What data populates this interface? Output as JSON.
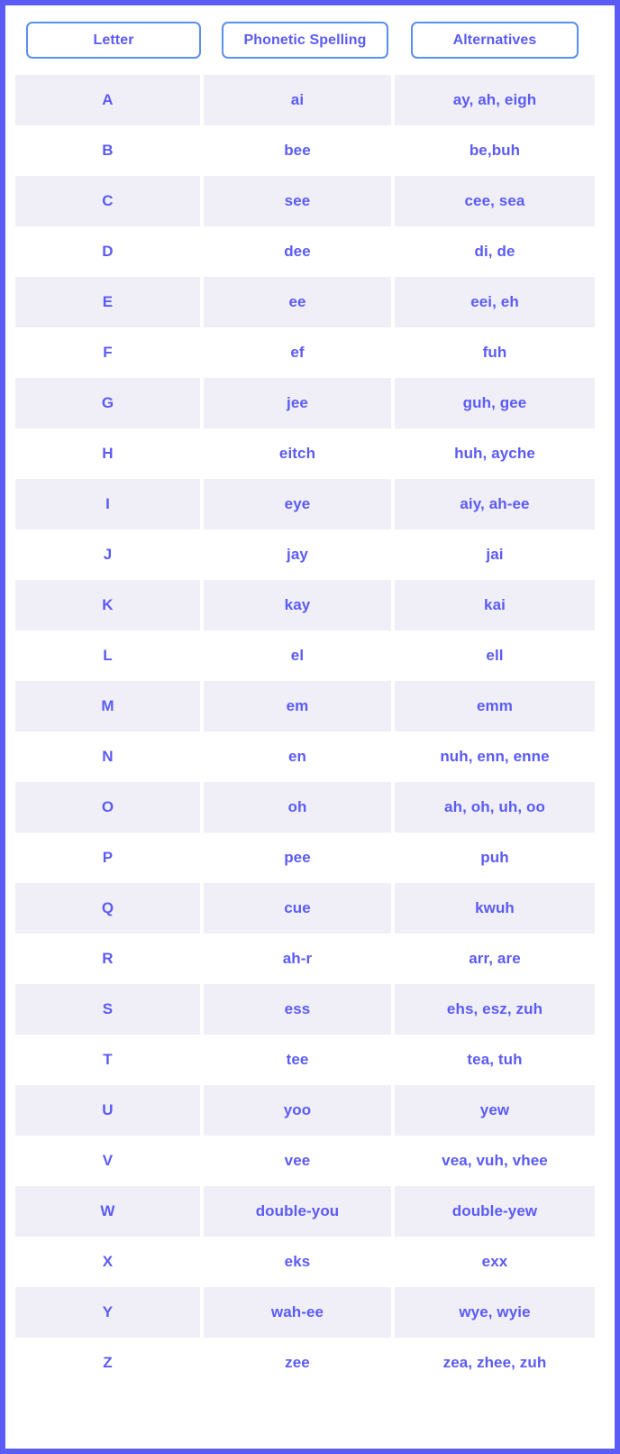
{
  "colors": {
    "frame_border": "#5b5bf5",
    "header_cell_border": "#5b8ff0",
    "text": "#5b5bf5",
    "row_shaded_background": "#f0eff8",
    "row_plain_background": "#ffffff",
    "card_background": "#ffffff"
  },
  "header": {
    "columns": [
      {
        "label": "Letter"
      },
      {
        "label": "Phonetic Spelling"
      },
      {
        "label": "Alternatives"
      }
    ]
  },
  "rows": [
    {
      "letter": "A",
      "phonetic": "ai",
      "alternatives": "ay, ah, eigh"
    },
    {
      "letter": "B",
      "phonetic": "bee",
      "alternatives": "be,buh"
    },
    {
      "letter": "C",
      "phonetic": "see",
      "alternatives": "cee, sea"
    },
    {
      "letter": "D",
      "phonetic": "dee",
      "alternatives": "di, de"
    },
    {
      "letter": "E",
      "phonetic": "ee",
      "alternatives": "eei, eh"
    },
    {
      "letter": "F",
      "phonetic": "ef",
      "alternatives": "fuh"
    },
    {
      "letter": "G",
      "phonetic": "jee",
      "alternatives": "guh, gee"
    },
    {
      "letter": "H",
      "phonetic": "eitch",
      "alternatives": "huh, ayche"
    },
    {
      "letter": "I",
      "phonetic": "eye",
      "alternatives": "aiy, ah-ee"
    },
    {
      "letter": "J",
      "phonetic": "jay",
      "alternatives": "jai"
    },
    {
      "letter": "K",
      "phonetic": "kay",
      "alternatives": "kai"
    },
    {
      "letter": "L",
      "phonetic": "el",
      "alternatives": "ell"
    },
    {
      "letter": "M",
      "phonetic": "em",
      "alternatives": "emm"
    },
    {
      "letter": "N",
      "phonetic": "en",
      "alternatives": "nuh, enn, enne"
    },
    {
      "letter": "O",
      "phonetic": "oh",
      "alternatives": "ah, oh, uh, oo"
    },
    {
      "letter": "P",
      "phonetic": "pee",
      "alternatives": "puh"
    },
    {
      "letter": "Q",
      "phonetic": "cue",
      "alternatives": "kwuh"
    },
    {
      "letter": "R",
      "phonetic": "ah-r",
      "alternatives": "arr, are"
    },
    {
      "letter": "S",
      "phonetic": "ess",
      "alternatives": "ehs, esz, zuh"
    },
    {
      "letter": "T",
      "phonetic": "tee",
      "alternatives": "tea, tuh"
    },
    {
      "letter": "U",
      "phonetic": "yoo",
      "alternatives": "yew"
    },
    {
      "letter": "V",
      "phonetic": "vee",
      "alternatives": "vea, vuh, vhee"
    },
    {
      "letter": "W",
      "phonetic": "double-you",
      "alternatives": "double-yew"
    },
    {
      "letter": "X",
      "phonetic": "eks",
      "alternatives": "exx"
    },
    {
      "letter": "Y",
      "phonetic": "wah-ee",
      "alternatives": "wye, wyie"
    },
    {
      "letter": "Z",
      "phonetic": "zee",
      "alternatives": "zea, zhee, zuh"
    }
  ]
}
